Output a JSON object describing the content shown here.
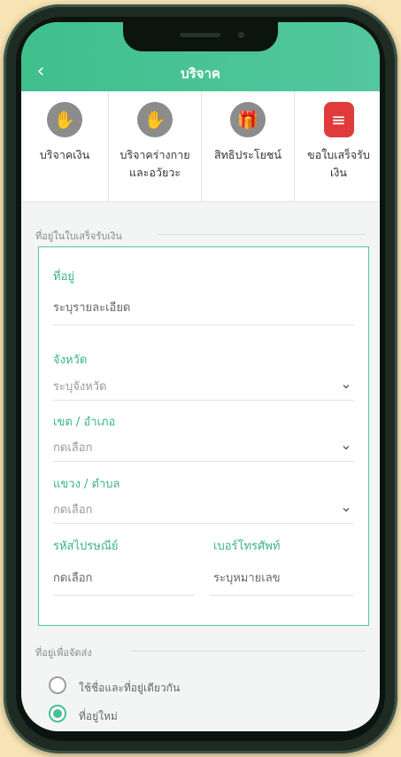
{
  "app": {
    "title": "บริจาค"
  },
  "menu": {
    "items": [
      {
        "label": "บริจาคเงิน",
        "icon": "hand-coin-icon"
      },
      {
        "label": "บริจาคร่างกาย และอวัยวะ",
        "icon": "raised-hand-icon"
      },
      {
        "label": "สิทธิประโยชน์",
        "icon": "gift-icon"
      },
      {
        "label": "ขอใบเสร็จรับ เงิน",
        "icon": "receipt-icon"
      }
    ]
  },
  "section_receipt_address": "ที่อยู่ในใบเสร็จรับเงิน",
  "form": {
    "address": {
      "label": "ที่อยู่",
      "value": "ระบุรายละเอียด"
    },
    "province": {
      "label": "จังหวัด",
      "placeholder": "ระบุจังหวัด"
    },
    "district": {
      "label": "เขต / อำเภอ",
      "placeholder": "กดเลือก"
    },
    "subdistrict": {
      "label": "แขวง / ตำบล",
      "placeholder": "กดเลือก"
    },
    "postal": {
      "label": "รหัสไปรษณีย์",
      "placeholder": "กดเลือก"
    },
    "phone": {
      "label": "เบอร์โทรศัพท์",
      "placeholder": "ระบุหมายเลข"
    }
  },
  "section_shipping_address": "ที่อยู่เพื่อจัดส่ง",
  "shipping": {
    "options": [
      {
        "label": "ใช้ชื่อและที่อยู่เดียวกัน",
        "selected": false
      },
      {
        "label": "ที่อยู่ใหม่",
        "selected": true
      }
    ]
  },
  "colors": {
    "accent": "#46c193",
    "header": "#4cc49a",
    "active_icon": "#e03b3b"
  }
}
